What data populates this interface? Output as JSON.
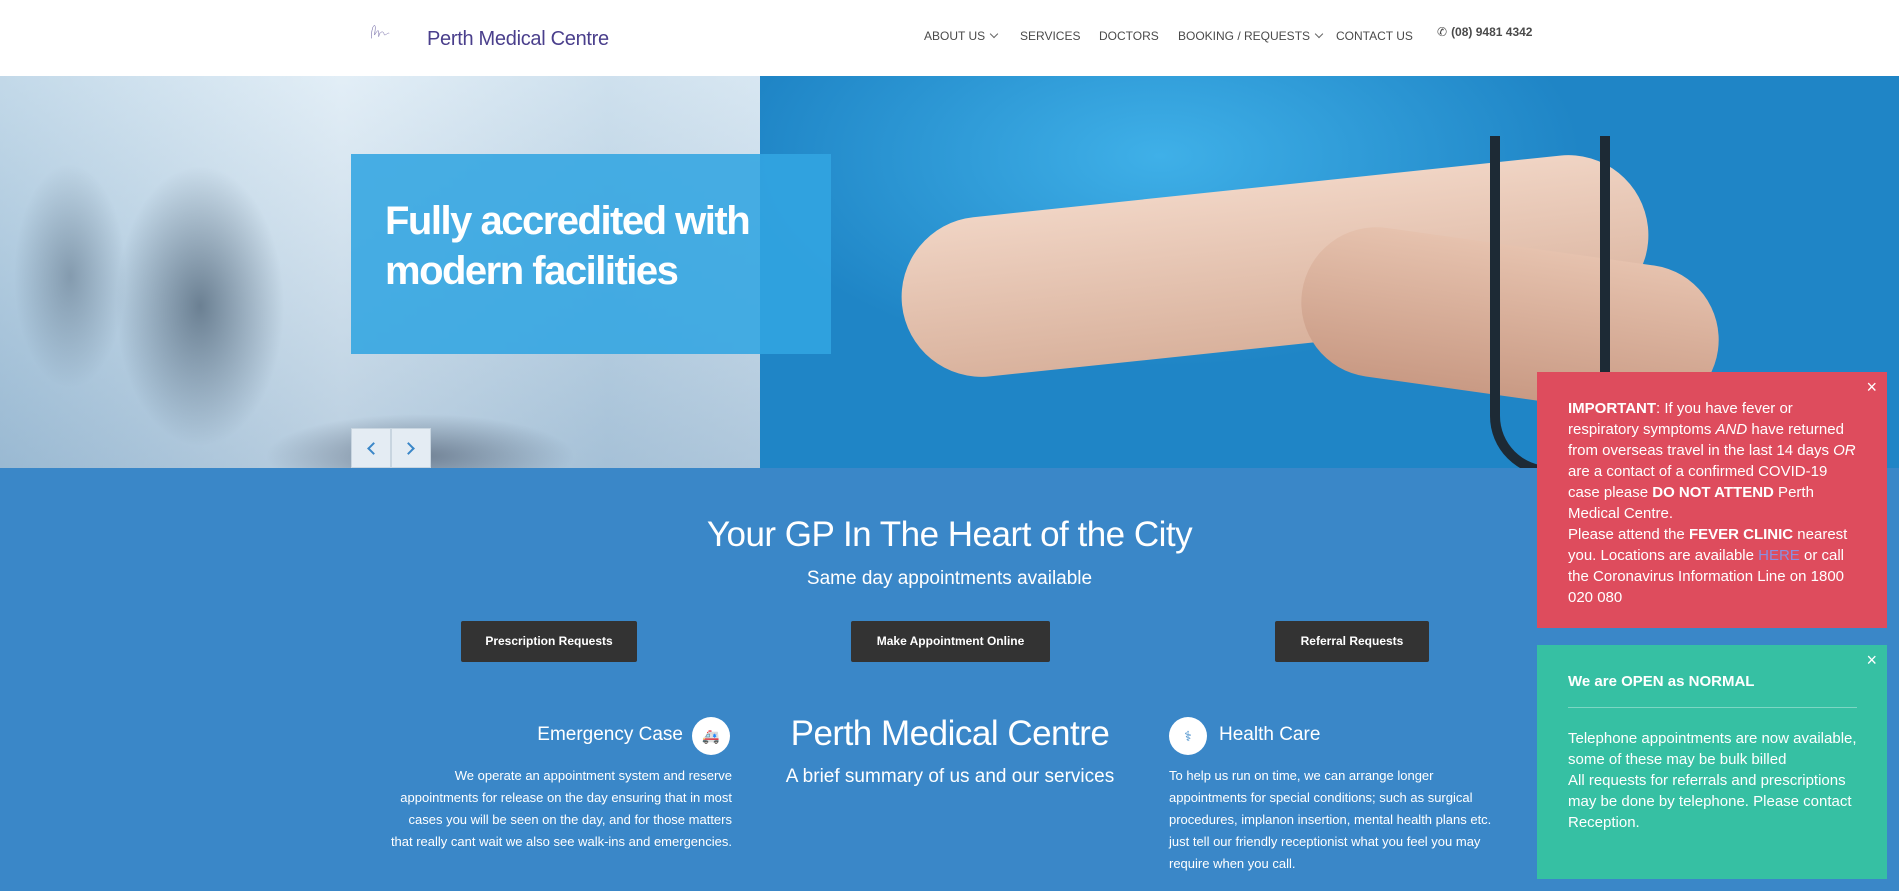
{
  "header": {
    "logo_text": "Perth Medical Centre",
    "nav": [
      {
        "label": "ABOUT US",
        "has_dropdown": true
      },
      {
        "label": "SERVICES",
        "has_dropdown": false
      },
      {
        "label": "DOCTORS",
        "has_dropdown": false
      },
      {
        "label": "BOOKING / REQUESTS",
        "has_dropdown": true
      },
      {
        "label": "CONTACT US",
        "has_dropdown": false
      }
    ],
    "phone": "(08) 9481 4342",
    "phone_icon": "phone-icon"
  },
  "hero": {
    "title_line1": "Fully accredited with",
    "title_line2": "modern facilities"
  },
  "main": {
    "title": "Your GP In The Heart of the City",
    "subtitle": "Same day appointments available",
    "buttons": {
      "prescription": "Prescription Requests",
      "appointment": "Make Appointment Online",
      "referral": "Referral Requests"
    },
    "emergency": {
      "title": "Emergency Case",
      "icon": "ambulance-icon",
      "line1": "We operate an appointment system and reserve",
      "line2": "appointments for release on the day ensuring that in most",
      "line3": "cases you will be seen on the day, and for those matters",
      "line4": "that really cant wait we also see walk-ins and emergencies."
    },
    "center": {
      "title": "Perth Medical Centre",
      "subtitle": "A brief summary of us and our services"
    },
    "healthcare": {
      "title": "Health Care",
      "icon": "stethoscope-icon",
      "line1": "To help us run on time, we can arrange longer",
      "line2": "appointments for special conditions; such as surgical",
      "line3": "procedures, implanon insertion, mental health plans etc.",
      "line4": "just tell our friendly receptionist what you feel you may",
      "line5": "require when you call."
    }
  },
  "notices": {
    "red": {
      "important": "IMPORTANT",
      "t1": ": If you have fever or respiratory symptoms ",
      "and": "AND",
      "t2": " have returned from overseas travel in the last 14 days ",
      "or": "OR",
      "t3": " are a contact of a confirmed COVID-19 case please ",
      "do_not_attend": "DO NOT ATTEND",
      "t4": " Perth Medical Centre.",
      "t5": "Please attend the ",
      "fever_clinic": "FEVER CLINIC",
      "t6": " nearest you.  Locations are available ",
      "here": "HERE",
      "t7": " or call the Coronavirus Information Line on 1800 020 080",
      "color": "#de4c5d"
    },
    "green": {
      "t1": "We are ",
      "open": "OPEN",
      "t2": " as ",
      "normal": "NORMAL",
      "p1": "Telephone appointments are now available, some of these may be bulk billed",
      "p2": "All requests for referrals and prescriptions may be done by telephone. Please contact Reception.",
      "color": "#36c0a3"
    },
    "close_symbol": "×"
  },
  "colors": {
    "brand_blue": "#3a87c8",
    "logo_purple": "#4a3f8c",
    "button_dark": "#333333"
  }
}
